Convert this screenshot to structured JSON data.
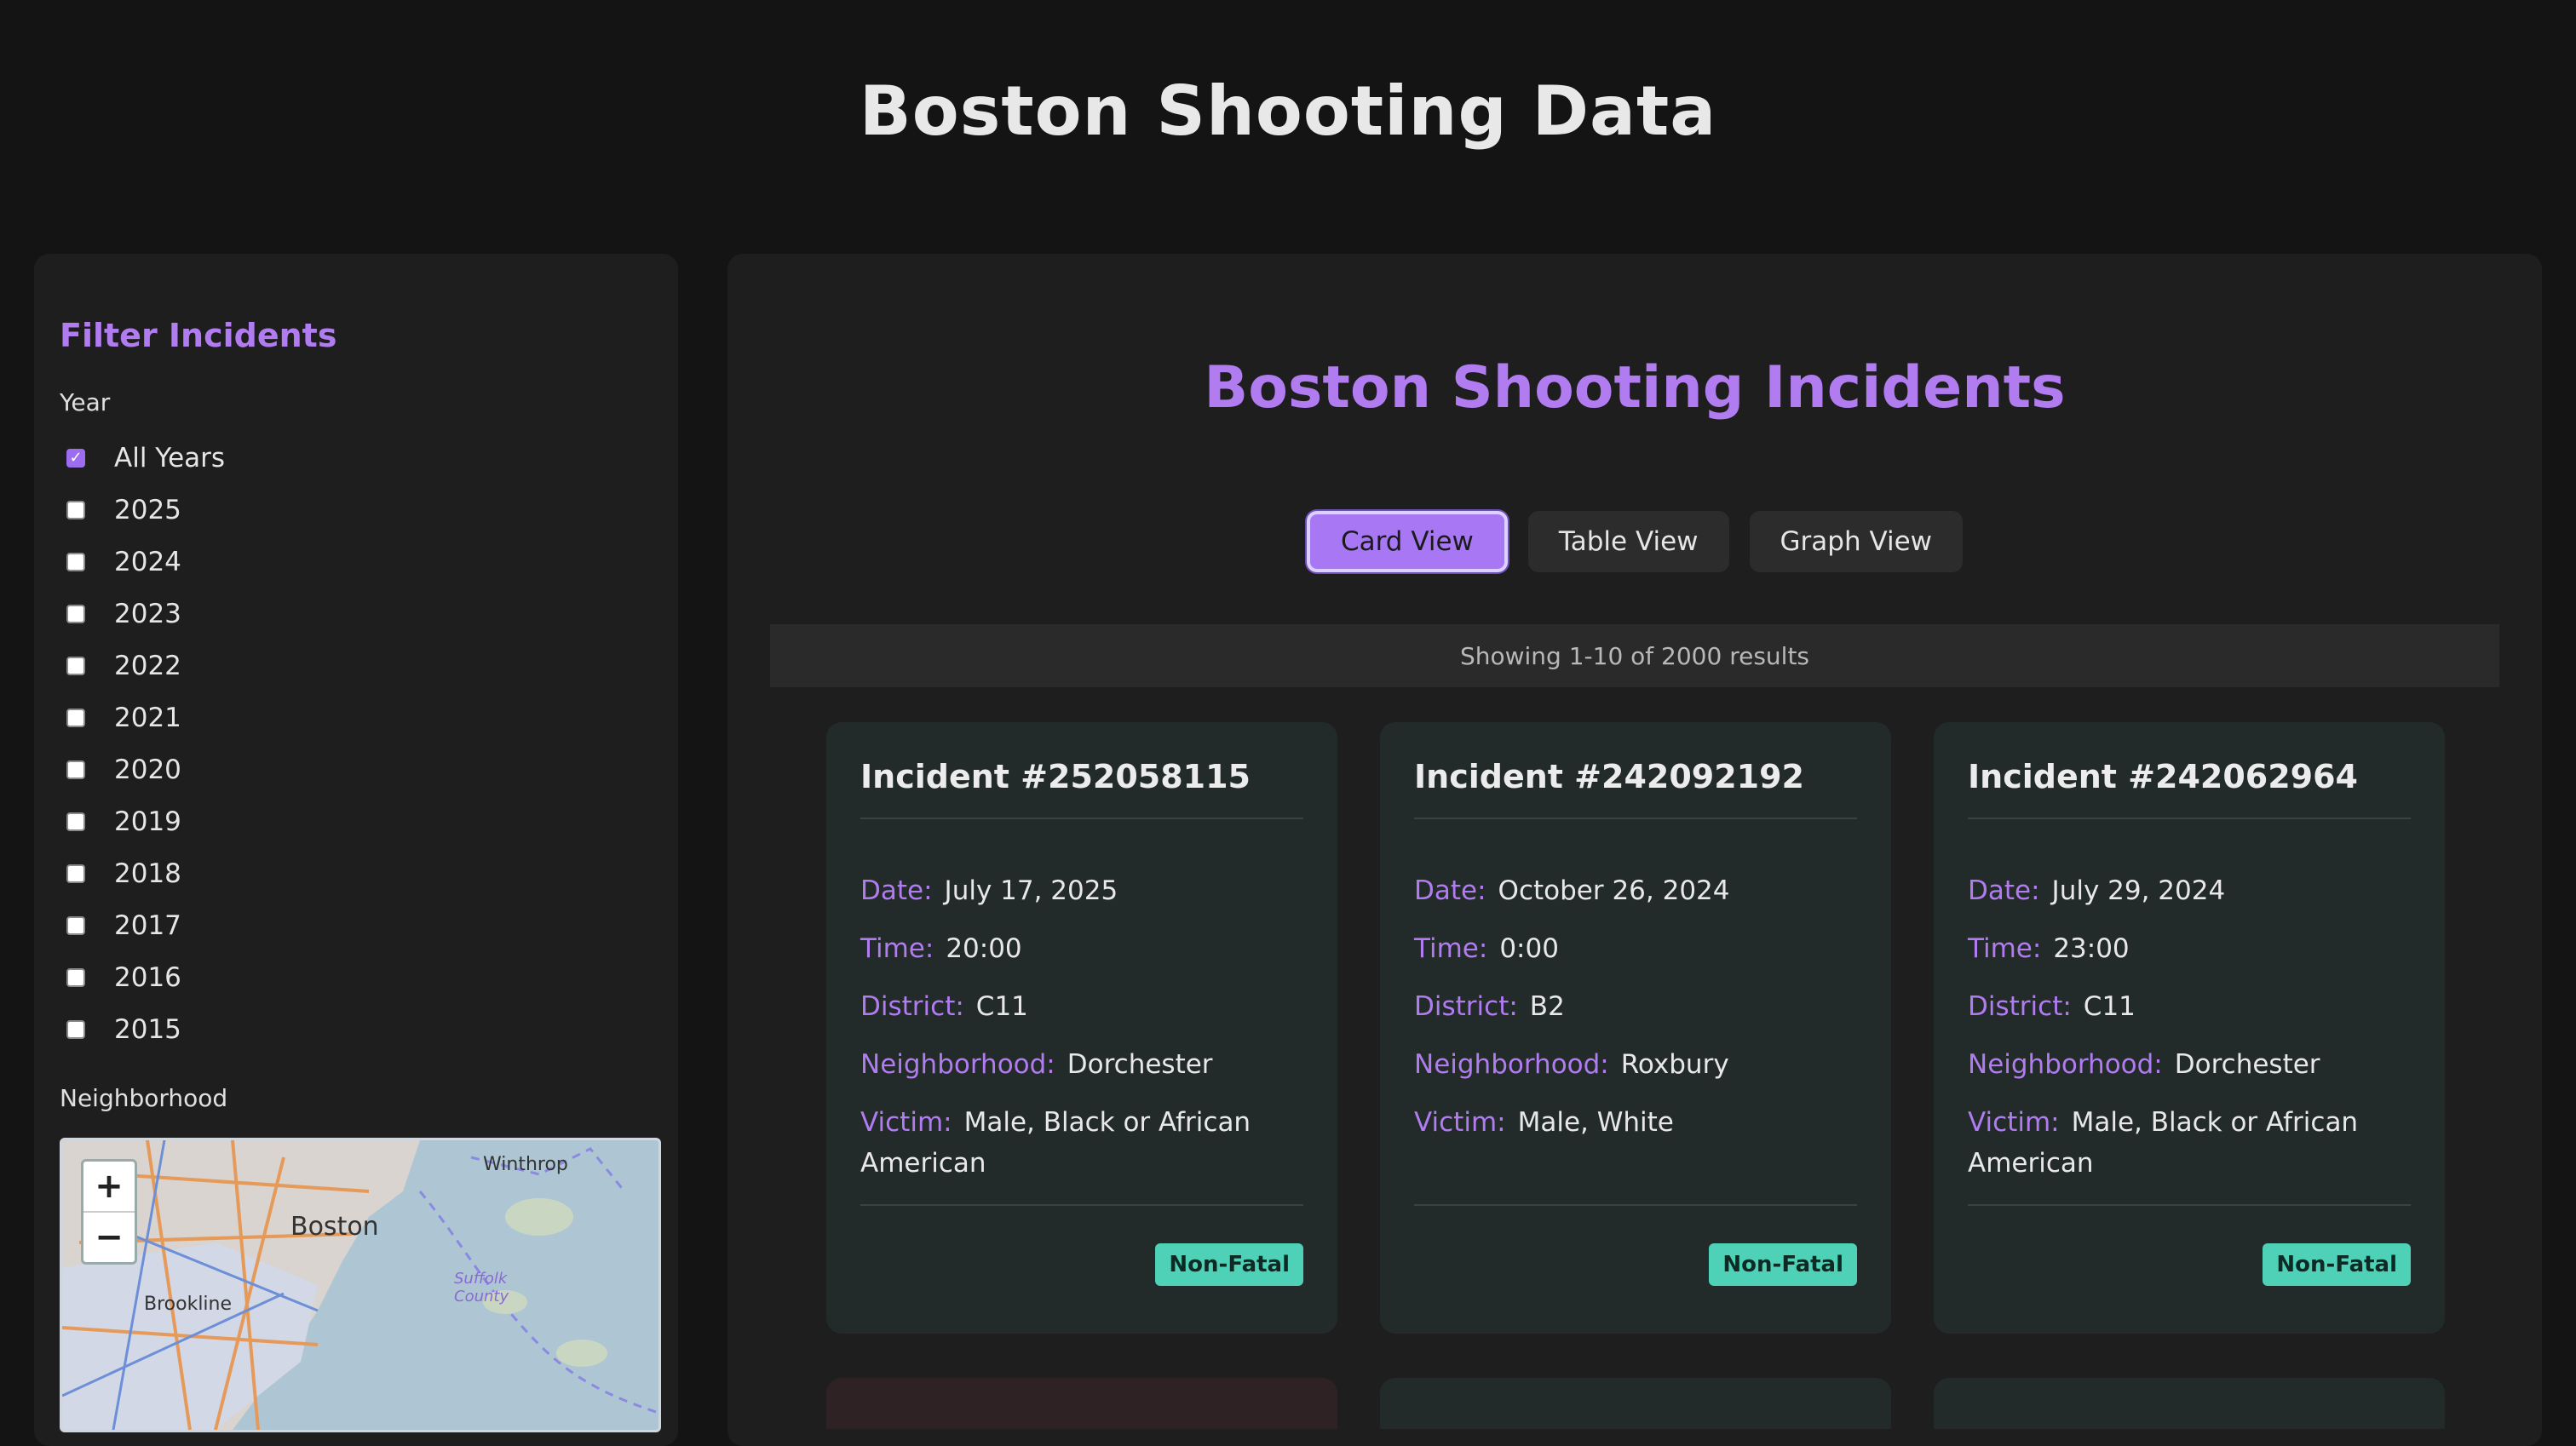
{
  "header": {
    "title": "Boston Shooting Data"
  },
  "sidebar": {
    "title": "Filter Incidents",
    "year_label": "Year",
    "years": [
      {
        "label": "All Years",
        "checked": true
      },
      {
        "label": "2025",
        "checked": false
      },
      {
        "label": "2024",
        "checked": false
      },
      {
        "label": "2023",
        "checked": false
      },
      {
        "label": "2022",
        "checked": false
      },
      {
        "label": "2021",
        "checked": false
      },
      {
        "label": "2020",
        "checked": false
      },
      {
        "label": "2019",
        "checked": false
      },
      {
        "label": "2018",
        "checked": false
      },
      {
        "label": "2017",
        "checked": false
      },
      {
        "label": "2016",
        "checked": false
      },
      {
        "label": "2015",
        "checked": false
      }
    ],
    "neighborhood_label": "Neighborhood",
    "map": {
      "zoom_in": "+",
      "zoom_out": "−",
      "labels": [
        "Boston",
        "Brookline",
        "Winthrop",
        "Suffolk County"
      ]
    }
  },
  "main": {
    "title": "Boston Shooting Incidents",
    "views": [
      {
        "label": "Card View",
        "active": true
      },
      {
        "label": "Table View",
        "active": false
      },
      {
        "label": "Graph View",
        "active": false
      }
    ],
    "results_text": "Showing 1-10 of 2000 results",
    "cards": [
      {
        "title": "Incident #252058115",
        "fields": [
          {
            "key": "Date:",
            "value": "July 17, 2025"
          },
          {
            "key": "Time:",
            "value": "20:00"
          },
          {
            "key": "District:",
            "value": "C11"
          },
          {
            "key": "Neighborhood:",
            "value": "Dorchester"
          },
          {
            "key": "Victim:",
            "value": "Male, Black or African American"
          }
        ],
        "badge": "Non-Fatal"
      },
      {
        "title": "Incident #242092192",
        "fields": [
          {
            "key": "Date:",
            "value": "October 26, 2024"
          },
          {
            "key": "Time:",
            "value": "0:00"
          },
          {
            "key": "District:",
            "value": "B2"
          },
          {
            "key": "Neighborhood:",
            "value": "Roxbury"
          },
          {
            "key": "Victim:",
            "value": "Male, White"
          }
        ],
        "badge": "Non-Fatal"
      },
      {
        "title": "Incident #242062964",
        "fields": [
          {
            "key": "Date:",
            "value": "July 29, 2024"
          },
          {
            "key": "Time:",
            "value": "23:00"
          },
          {
            "key": "District:",
            "value": "C11"
          },
          {
            "key": "Neighborhood:",
            "value": "Dorchester"
          },
          {
            "key": "Victim:",
            "value": "Male, Black or African American"
          }
        ],
        "badge": "Non-Fatal"
      }
    ]
  },
  "colors": {
    "accent": "#b07cf0",
    "badge_nonfatal": "#4fd1b8",
    "background": "#141414",
    "panel": "#1e1e1e",
    "card": "#232a2a"
  }
}
